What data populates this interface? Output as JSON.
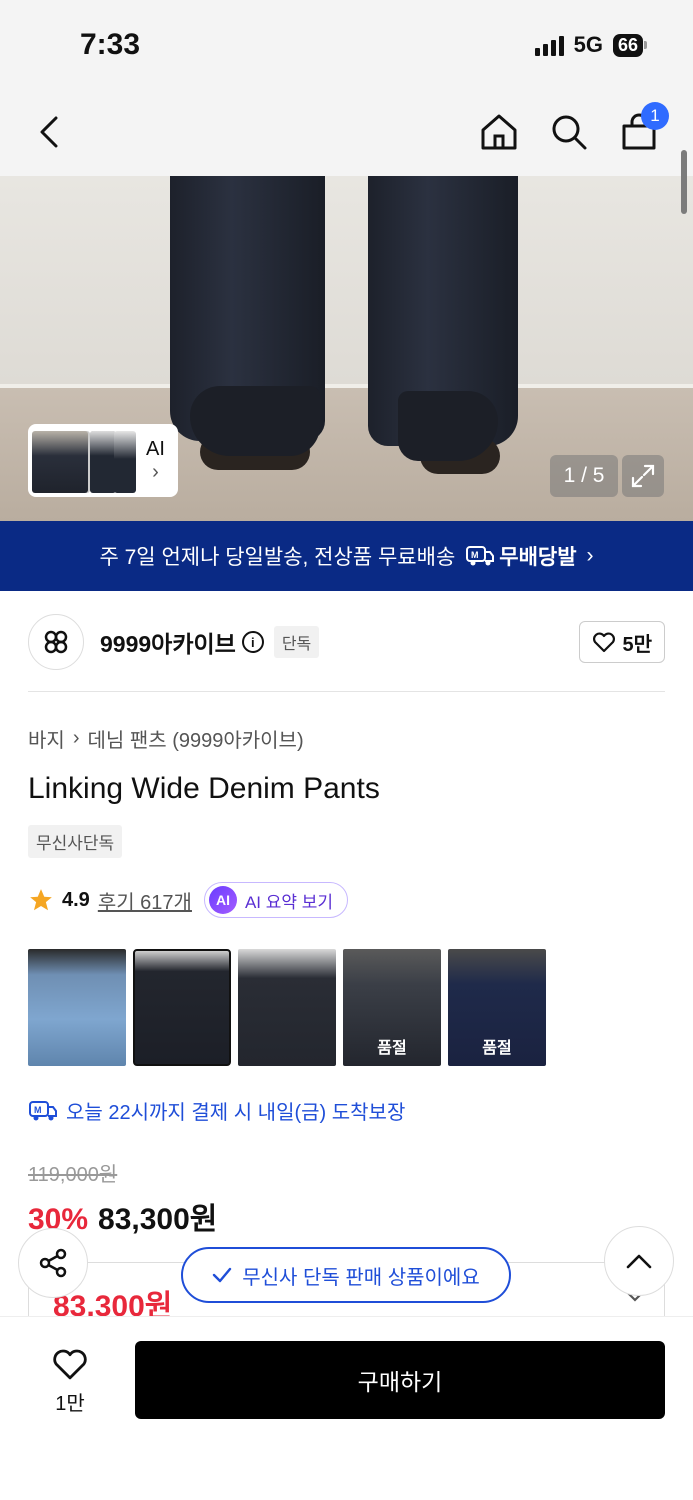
{
  "status_bar": {
    "time": "7:33",
    "network": "5G",
    "battery": "66"
  },
  "nav": {
    "cart_count": "1"
  },
  "hero": {
    "ai_label": "AI",
    "ai_chevron": "›",
    "pager": "1 / 5"
  },
  "banner": {
    "text": "주 7일 언제나 당일발송, 전상품 무료배송",
    "brand": "무배당발",
    "chevron": "›"
  },
  "brand": {
    "name": "9999아카이브",
    "info": "i",
    "exclusive": "단독",
    "likes": "5만"
  },
  "breadcrumb": {
    "category": "바지",
    "sep": "›",
    "sub": "데님 팬츠 (9999아카이브)"
  },
  "product": {
    "title": "Linking Wide Denim Pants",
    "tag": "무신사단독",
    "rating": "4.9",
    "reviews": "후기 617개",
    "ai_badge": "AI",
    "ai_summary": "AI 요약 보기"
  },
  "variants": [
    {
      "soldout": ""
    },
    {
      "soldout": ""
    },
    {
      "soldout": ""
    },
    {
      "soldout": "품절"
    },
    {
      "soldout": "품절"
    }
  ],
  "delivery": {
    "text": "오늘 22시까지 결제 시 내일(금) 도착보장"
  },
  "price": {
    "original": "119,000원",
    "discount": "30%",
    "sale": "83,300원",
    "benefit_price": "83,300원"
  },
  "toast": {
    "text": "무신사 단독 판매 상품이에요"
  },
  "bottom": {
    "wish_count": "1만",
    "buy_label": "구매하기"
  },
  "colors": {
    "accent_blue": "#1f4ed8",
    "banner_navy": "#0a2a85",
    "discount_red": "#e8283b",
    "ai_purple": "#5a2fd3"
  }
}
